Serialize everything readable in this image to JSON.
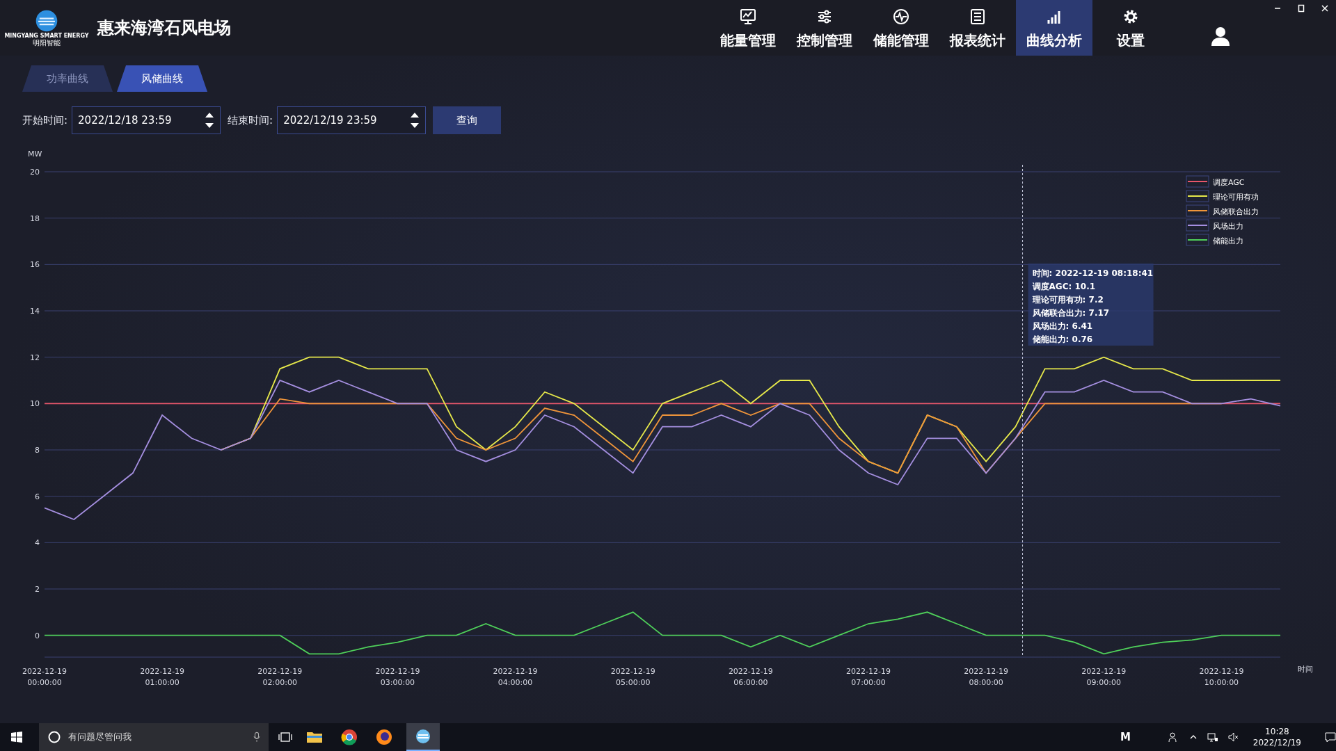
{
  "header": {
    "logo_text": "MINGYANG SMART ENERGY",
    "logo_subtext": "明阳智能",
    "title": "惠来海湾石风电场"
  },
  "nav": [
    {
      "label": "能量管理",
      "selected": false
    },
    {
      "label": "控制管理",
      "selected": false
    },
    {
      "label": "储能管理",
      "selected": false
    },
    {
      "label": "报表统计",
      "selected": false
    },
    {
      "label": "曲线分析",
      "selected": true
    },
    {
      "label": "设置",
      "selected": false
    }
  ],
  "tabs": [
    {
      "label": "功率曲线",
      "selected": false
    },
    {
      "label": "风储曲线",
      "selected": true
    }
  ],
  "filter": {
    "start_label": "开始时间:",
    "start_value": "2022/12/18 23:59",
    "end_label": "结束时间:",
    "end_value": "2022/12/19 23:59",
    "query_button": "查询"
  },
  "chart": {
    "chart_data": {
      "type": "line",
      "ylabel": "MW",
      "xlabel": "时间",
      "categories": [
        "2022-12-19 00:00:00",
        null,
        null,
        null,
        "2022-12-19 01:00:00",
        null,
        null,
        null,
        "2022-12-19 02:00:00",
        null,
        null,
        null,
        "2022-12-19 03:00:00",
        null,
        null,
        null,
        "2022-12-19 04:00:00",
        null,
        null,
        null,
        "2022-12-19 05:00:00",
        null,
        null,
        null,
        "2022-12-19 06:00:00",
        null,
        null,
        null,
        "2022-12-19 07:00:00",
        null,
        null,
        null,
        "2022-12-19 08:00:00",
        null,
        null,
        null,
        "2022-12-19 09:00:00",
        null,
        null,
        null,
        "2022-12-19 10:00:00",
        null,
        null
      ],
      "series": [
        {
          "name": "调度AGC",
          "color": "#e8566a",
          "values": [
            10,
            10,
            10,
            10,
            10,
            10,
            10,
            10,
            10,
            10,
            10,
            10,
            10,
            10,
            10,
            10,
            10,
            10,
            10,
            10,
            10,
            10,
            10,
            10,
            10,
            10,
            10,
            10,
            10,
            10,
            10,
            10,
            10,
            10,
            10,
            10,
            10,
            10,
            10,
            10,
            10,
            10,
            10
          ]
        },
        {
          "name": "理论可用有功",
          "color": "#e6e84a",
          "values": [
            null,
            null,
            null,
            null,
            null,
            null,
            8,
            8.5,
            11.5,
            12,
            12,
            11.5,
            11.5,
            11.5,
            9,
            8,
            9,
            10.5,
            10,
            9,
            8,
            10,
            10.5,
            11,
            10,
            11,
            11,
            9,
            7.5,
            7,
            9.5,
            9,
            7.5,
            9,
            11.5,
            11.5,
            12,
            11.5,
            11.5,
            11,
            11,
            11,
            11
          ]
        },
        {
          "name": "风储联合出力",
          "color": "#f0953a",
          "values": [
            null,
            null,
            null,
            null,
            null,
            null,
            8,
            8.5,
            10.2,
            10,
            10,
            10,
            10,
            10,
            8.5,
            8,
            8.5,
            9.8,
            9.5,
            8.5,
            7.5,
            9.5,
            9.5,
            10,
            9.5,
            10,
            10,
            8.5,
            7.5,
            7,
            9.5,
            9,
            7,
            8.5,
            10,
            10,
            10,
            10,
            10,
            10,
            10,
            null,
            null
          ]
        },
        {
          "name": "风场出力",
          "color": "#a58fe0",
          "values": [
            5.5,
            5,
            6,
            7,
            9.5,
            8.5,
            8,
            8.5,
            11,
            10.5,
            11,
            10.5,
            10,
            10,
            8,
            7.5,
            8,
            9.5,
            9,
            8,
            7,
            9,
            9,
            9.5,
            9,
            10,
            9.5,
            8,
            7,
            6.5,
            8.5,
            8.5,
            7,
            8.5,
            10.5,
            10.5,
            11,
            10.5,
            10.5,
            10,
            10,
            10.2,
            9.9
          ]
        },
        {
          "name": "储能出力",
          "color": "#4fd05a",
          "values": [
            0,
            0,
            0,
            0,
            0,
            0,
            0,
            0,
            0,
            -0.8,
            -0.8,
            -0.5,
            -0.3,
            0,
            0,
            0.5,
            0,
            0,
            0,
            0.5,
            1,
            0,
            0,
            0,
            -0.5,
            0,
            -0.5,
            0,
            0.5,
            0.7,
            1,
            0.5,
            0,
            0,
            0,
            -0.3,
            -0.8,
            -0.5,
            -0.3,
            -0.2,
            0,
            0,
            0
          ]
        }
      ],
      "ylim": [
        -1,
        20
      ],
      "yticks": [
        0,
        2,
        4,
        6,
        8,
        10,
        12,
        14,
        16,
        18,
        20
      ],
      "grid": true,
      "legend": true
    },
    "tooltip": [
      "时间: 2022-12-19 08:18:41",
      "调度AGC: 10.1",
      "理论可用有功: 7.2",
      "风储联合出力: 7.17",
      "风场出力: 6.41",
      "储能出力: 0.76"
    ]
  },
  "taskbar": {
    "search_placeholder": "有问题尽管问我",
    "tray_letter": "M",
    "clock_time": "10:28",
    "clock_date": "2022/12/19"
  }
}
